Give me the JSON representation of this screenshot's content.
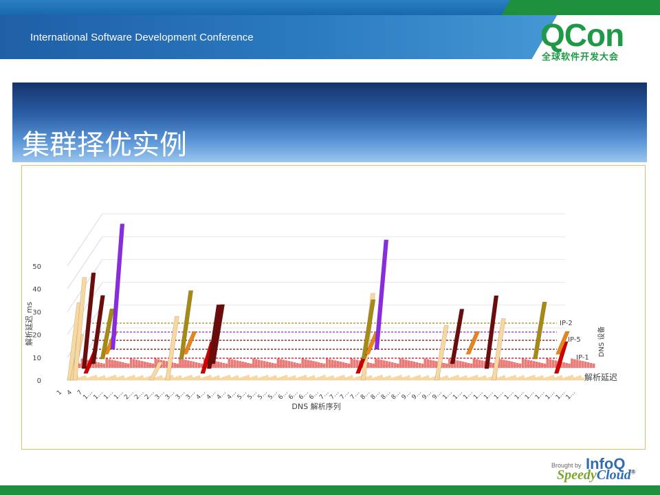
{
  "header": {
    "conference_title": "International Software Development Conference",
    "logo_text": "QCon",
    "logo_subtitle": "全球软件开发大会"
  },
  "slide": {
    "title": "集群择优实例"
  },
  "footer": {
    "brought_by": "Brought by",
    "brand1": "InfoQ",
    "brand2_a": "Speedy",
    "brand2_b": "Cloud",
    "registered": "®"
  },
  "colors": {
    "brand_green": "#1e8f3c",
    "brand_blue": "#2a79bf",
    "series_front": "#f9d8a0",
    "series_back": "#ee7a78",
    "spike_purple": "#8a2be2",
    "spike_red": "#cc0000",
    "spike_orange": "#e6851b",
    "spike_olive": "#a58a13",
    "spike_darkred": "#6b0d0d"
  },
  "chart_data": {
    "type": "bar",
    "subtype": "3d-column",
    "xlabel": "DNS 解析序列",
    "ylabel": "解析延迟 ms",
    "zlabel": "DNS 设备",
    "ylim": [
      0,
      50
    ],
    "y_ticks": [
      "0",
      "10",
      "20",
      "30",
      "40",
      "50"
    ],
    "x_ticks": [
      "1",
      "4",
      "7",
      "1…",
      "1…",
      "1…",
      "1…",
      "2…",
      "2…",
      "2…",
      "3…",
      "3…",
      "3…",
      "3…",
      "4…",
      "4…",
      "4…",
      "4…",
      "5…",
      "5…",
      "5…",
      "5…",
      "6…",
      "6…",
      "6…",
      "6…",
      "7…",
      "7…",
      "7…",
      "7…",
      "8…",
      "8…",
      "8…",
      "8…",
      "9…",
      "9…",
      "9…",
      "9…",
      "1…",
      "1…",
      "1…",
      "1…",
      "1…",
      "1…",
      "1…",
      "1…",
      "1…",
      "1…",
      "1…",
      "1…",
      "1…"
    ],
    "series": [
      {
        "name": "解析延迟",
        "spikes": [
          {
            "index": 0,
            "value": 34
          },
          {
            "index": 1,
            "value": 20
          },
          {
            "index": 2,
            "value": 45
          },
          {
            "index": 30,
            "value": 8
          },
          {
            "index": 36,
            "value": 28
          },
          {
            "index": 108,
            "value": 38
          },
          {
            "index": 135,
            "value": 24
          },
          {
            "index": 156,
            "value": 27
          }
        ]
      },
      {
        "name": "IP-1",
        "spikes": [
          {
            "index": 4,
            "value": 10
          },
          {
            "index": 47,
            "value": 14
          },
          {
            "index": 104,
            "value": 11
          },
          {
            "index": 177,
            "value": 14
          }
        ]
      },
      {
        "name": "IP-5",
        "spikes": [
          {
            "index": 2,
            "value": 42
          },
          {
            "index": 48,
            "value": 28
          },
          {
            "index": 150,
            "value": 32
          }
        ]
      },
      {
        "name": "IP-2",
        "spikes": [
          {
            "index": 4,
            "value": 30
          },
          {
            "index": 48,
            "value": 26
          },
          {
            "index": 136,
            "value": 24
          }
        ]
      },
      {
        "name": "",
        "spikes": [
          {
            "index": 6,
            "value": 22
          },
          {
            "index": 35,
            "value": 30
          },
          {
            "index": 102,
            "value": 26
          },
          {
            "index": 165,
            "value": 25
          }
        ]
      },
      {
        "name": "",
        "spikes": [
          {
            "index": 6,
            "value": 10
          },
          {
            "index": 35,
            "value": 10
          },
          {
            "index": 102,
            "value": 10
          },
          {
            "index": 139,
            "value": 10
          },
          {
            "index": 172,
            "value": 10
          }
        ]
      },
      {
        "name": "",
        "spikes": [
          {
            "index": 7,
            "value": 55
          },
          {
            "index": 104,
            "value": 48
          }
        ]
      }
    ],
    "legend_placement": "right-depth-axis",
    "depth_labels": [
      "解析延迟",
      "IP-1",
      "IP-5",
      "IP-2"
    ],
    "grid": true
  }
}
